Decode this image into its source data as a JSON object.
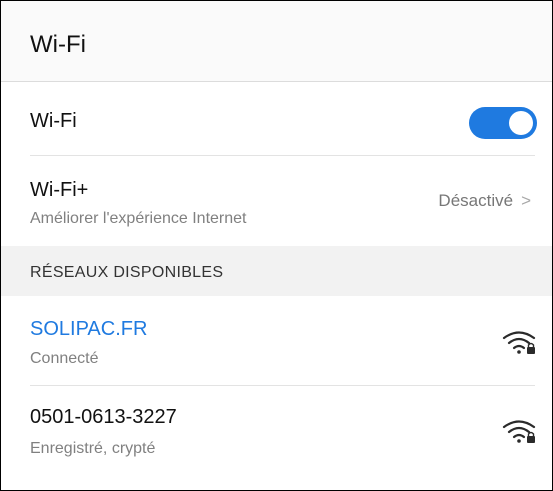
{
  "header": {
    "title": "Wi-Fi"
  },
  "wifi_row": {
    "label": "Wi-Fi",
    "toggle_on": true,
    "toggle_color": "#1f7ae0"
  },
  "wifiplus_row": {
    "label": "Wi-Fi+",
    "sublabel": "Améliorer l'expérience Internet",
    "value": "Désactivé",
    "chevron_icon": "chevron-right-icon"
  },
  "section": {
    "title": "RÉSEAUX DISPONIBLES"
  },
  "networks": [
    {
      "name": "SOLIPAC.FR",
      "status": "Connecté",
      "name_color": "#1f7ae0",
      "icon": "wifi-locked-icon"
    },
    {
      "name": "0501-0613-3227",
      "status": "Enregistré, crypté",
      "name_color": "#111111",
      "icon": "wifi-locked-icon"
    }
  ]
}
